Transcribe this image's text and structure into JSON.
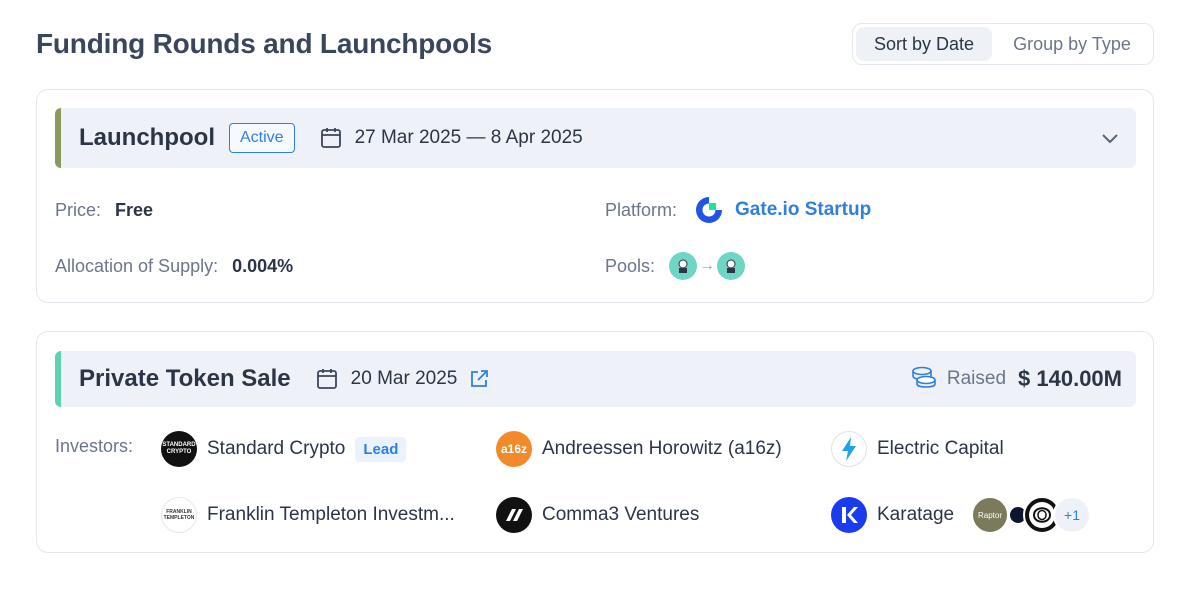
{
  "header": {
    "title": "Funding Rounds and Launchpools",
    "sort_by_date": "Sort by Date",
    "group_by_type": "Group by Type"
  },
  "launchpool": {
    "title": "Launchpool",
    "status": "Active",
    "date_range": "27 Mar 2025 — 8 Apr 2025",
    "price_label": "Price:",
    "price_value": "Free",
    "allocation_label": "Allocation of Supply:",
    "allocation_value": "0.004%",
    "platform_label": "Platform:",
    "platform_name": "Gate.io Startup",
    "pools_label": "Pools:"
  },
  "private_sale": {
    "title": "Private Token Sale",
    "date": "20 Mar 2025",
    "raised_label": "Raised",
    "raised_value": "$ 140.00M",
    "investors_label": "Investors:",
    "lead_label": "Lead",
    "investors": [
      {
        "name": "Standard Crypto",
        "logo_text": "STANDARD CRYPTO"
      },
      {
        "name": "Andreessen Horowitz (a16z)",
        "logo_text": "a16z"
      },
      {
        "name": "Electric Capital"
      },
      {
        "name": "Franklin Templeton Investm...",
        "logo_text": "FRANKLIN TEMPLETON"
      },
      {
        "name": "Comma3 Ventures"
      },
      {
        "name": "Karatage"
      }
    ],
    "extra_logo_text": "Raptor",
    "more_count": "+1"
  },
  "colors": {
    "accent_blue": "#2f7fe0",
    "launchpool_stripe": "#8a9a5c",
    "private_stripe": "#5dd3b0"
  }
}
